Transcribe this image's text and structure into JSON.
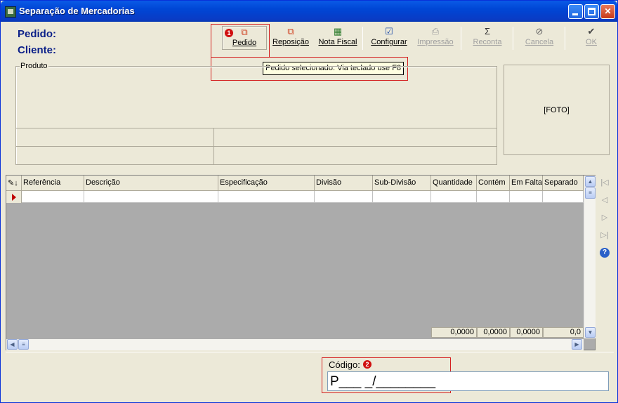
{
  "window": {
    "title": "Separação de Mercadorias"
  },
  "header": {
    "pedido_label": "Pedido:",
    "cliente_label": "Cliente:"
  },
  "toolbar": {
    "buttons": [
      {
        "label": "Pedido",
        "icon": "order-boxes-icon",
        "enabled": true
      },
      {
        "label": "Reposição",
        "icon": "replenish-boxes-icon",
        "enabled": true
      },
      {
        "label": "Nota Fiscal",
        "icon": "invoice-icon",
        "enabled": true
      },
      {
        "label": "Configurar",
        "icon": "configure-icon",
        "enabled": true
      },
      {
        "label": "Impressão",
        "icon": "printer-icon",
        "enabled": false
      },
      {
        "label": "Reconta",
        "icon": "sigma-icon",
        "enabled": false
      },
      {
        "label": "Cancela",
        "icon": "cancel-icon",
        "enabled": false
      },
      {
        "label": "OK",
        "icon": "checkmark-icon",
        "enabled": false
      }
    ]
  },
  "tooltip": "Pedido selecionado. Via teclado use F8",
  "annotations": {
    "marker1": "1",
    "marker2": "2",
    "color": "#d42020"
  },
  "produto": {
    "label": "Produto"
  },
  "photo": {
    "label": "[FOTO]"
  },
  "grid": {
    "columns": [
      "Referência",
      "Descrição",
      "Especificação",
      "Divisão",
      "Sub-Divisão",
      "Quantidade",
      "Contém",
      "Em Falta",
      "Separado"
    ],
    "totals": [
      "0,0000",
      "0,0000",
      "0,0000",
      "0,0"
    ]
  },
  "codigo": {
    "label": "Código:",
    "value": "P___ _/________"
  },
  "colors": {
    "title_blue": "#0046D5",
    "label_blue": "#0a1f88",
    "window_bg": "#ECE9D8"
  }
}
